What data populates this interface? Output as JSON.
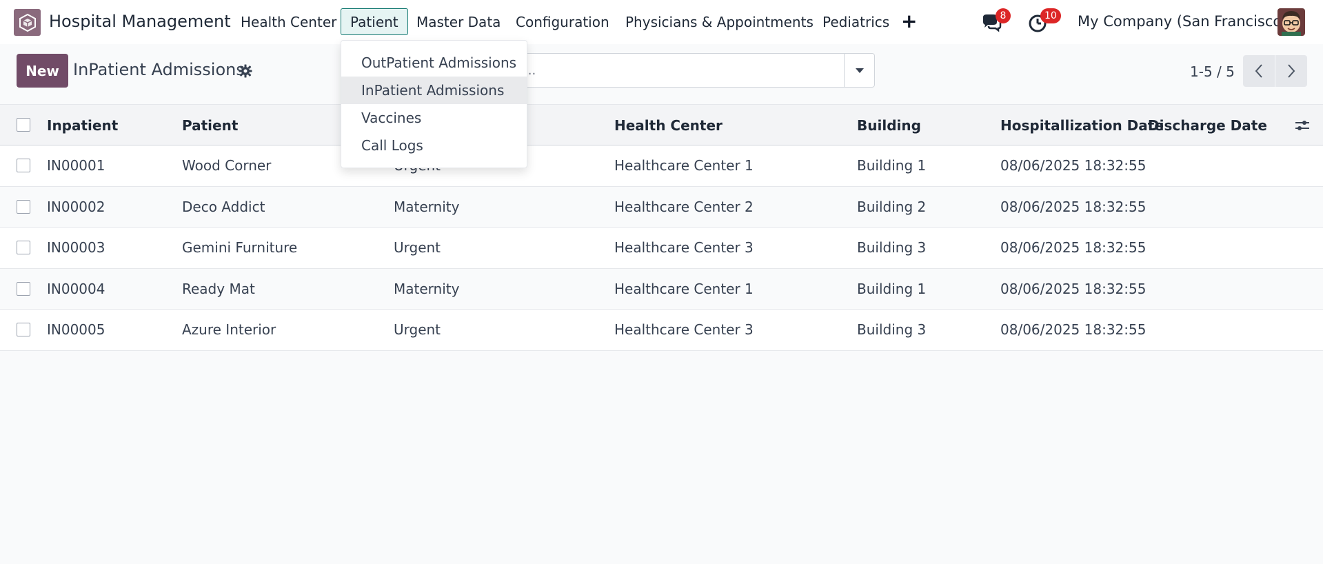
{
  "navbar": {
    "app_name": "Hospital Management",
    "menus": [
      {
        "label": "Health Center"
      },
      {
        "label": "Patient"
      },
      {
        "label": "Master Data"
      },
      {
        "label": "Configuration"
      },
      {
        "label": "Physicians & Appointments"
      },
      {
        "label": "Pediatrics"
      }
    ],
    "plus_icon": "+",
    "messages_badge": "8",
    "activities_badge": "10",
    "company": "My Company (San Francisco)",
    "accent_color": "#714b67",
    "badge_color": "#dc2626"
  },
  "dropdown": {
    "items": [
      {
        "label": "OutPatient Admissions"
      },
      {
        "label": "InPatient Admissions"
      },
      {
        "label": "Vaccines"
      },
      {
        "label": "Call Logs"
      }
    ]
  },
  "control_panel": {
    "new_label": "New",
    "title": "InPatient Admissions",
    "search_value": "...",
    "pager": "1-5 / 5"
  },
  "table": {
    "columns": {
      "inpatient": "Inpatient",
      "patient": "Patient",
      "health_center": "Health Center",
      "building": "Building",
      "hospitalization_date": "Hospitallization Date",
      "discharge_date": "Discharge Date"
    },
    "rows": [
      {
        "inpatient": "IN00001",
        "patient": "Wood Corner",
        "type": "Urgent",
        "health_center": "Healthcare Center 1",
        "building": "Building 1",
        "hospitalization_date": "08/06/2025 18:32:55",
        "discharge_date": ""
      },
      {
        "inpatient": "IN00002",
        "patient": "Deco Addict",
        "type": "Maternity",
        "health_center": "Healthcare Center 2",
        "building": "Building 2",
        "hospitalization_date": "08/06/2025 18:32:55",
        "discharge_date": ""
      },
      {
        "inpatient": "IN00003",
        "patient": "Gemini Furniture",
        "type": "Urgent",
        "health_center": "Healthcare Center 3",
        "building": "Building 3",
        "hospitalization_date": "08/06/2025 18:32:55",
        "discharge_date": ""
      },
      {
        "inpatient": "IN00004",
        "patient": "Ready Mat",
        "type": "Maternity",
        "health_center": "Healthcare Center 1",
        "building": "Building 1",
        "hospitalization_date": "08/06/2025 18:32:55",
        "discharge_date": ""
      },
      {
        "inpatient": "IN00005",
        "patient": "Azure Interior",
        "type": "Urgent",
        "health_center": "Healthcare Center 3",
        "building": "Building 3",
        "hospitalization_date": "08/06/2025 18:32:55",
        "discharge_date": ""
      }
    ]
  }
}
